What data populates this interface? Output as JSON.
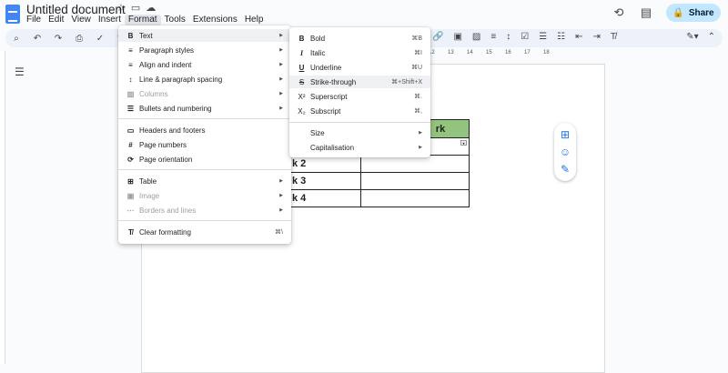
{
  "window": {
    "doc_title": "Untitled document"
  },
  "menubar": [
    "File",
    "Edit",
    "View",
    "Insert",
    "Format",
    "Tools",
    "Extensions",
    "Help"
  ],
  "share": {
    "label": "Share"
  },
  "ruler": {
    "marks": [
      "12",
      "13",
      "14",
      "15",
      "16",
      "17",
      "18"
    ]
  },
  "table": {
    "header": [
      "",
      "rk"
    ],
    "rows": [
      [
        "k 2",
        ""
      ],
      [
        "k 3",
        ""
      ],
      [
        "k 4",
        ""
      ]
    ]
  },
  "format_menu": {
    "items": [
      {
        "icon": "B",
        "label": "Text",
        "submenu": true,
        "active": true
      },
      {
        "icon": "≡",
        "label": "Paragraph styles",
        "submenu": true
      },
      {
        "icon": "≡",
        "label": "Align and indent",
        "submenu": true
      },
      {
        "icon": "↕",
        "label": "Line & paragraph spacing",
        "submenu": true
      },
      {
        "icon": "▥",
        "label": "Columns",
        "submenu": true,
        "disabled": true
      },
      {
        "icon": "☰",
        "label": "Bullets and numbering",
        "submenu": true
      },
      {
        "icon": "▭",
        "label": "Headers and footers"
      },
      {
        "icon": "#",
        "label": "Page numbers"
      },
      {
        "icon": "⟳",
        "label": "Page orientation"
      },
      {
        "icon": "⊞",
        "label": "Table",
        "submenu": true
      },
      {
        "icon": "▣",
        "label": "Image",
        "submenu": true,
        "disabled": true
      },
      {
        "icon": "⋯",
        "label": "Borders and lines",
        "submenu": true,
        "disabled": true
      },
      {
        "icon": "T̸",
        "label": "Clear formatting",
        "shortcut": "⌘\\"
      }
    ]
  },
  "text_menu": {
    "items": [
      {
        "icon": "B",
        "label": "Bold",
        "shortcut": "⌘B"
      },
      {
        "icon": "I",
        "label": "Italic",
        "shortcut": "⌘I"
      },
      {
        "icon": "U",
        "label": "Underline",
        "shortcut": "⌘U"
      },
      {
        "icon": "S",
        "label": "Strike-through",
        "shortcut": "⌘+Shift+X",
        "highlighted": true
      },
      {
        "icon": "X²",
        "label": "Superscript",
        "shortcut": "⌘."
      },
      {
        "icon": "X₂",
        "label": "Subscript",
        "shortcut": "⌘,"
      },
      {
        "icon": "",
        "label": "Size",
        "submenu": true
      },
      {
        "icon": "",
        "label": "Capitalisation",
        "submenu": true
      }
    ]
  }
}
